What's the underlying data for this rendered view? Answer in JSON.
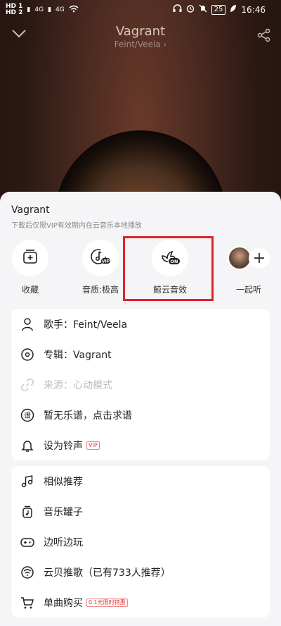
{
  "status": {
    "left_text": [
      "HD 1",
      "HD 2",
      "4G",
      "4G"
    ],
    "battery": "25",
    "time": "16:46"
  },
  "header": {
    "title": "Vagrant",
    "artist": "Feint/Veela",
    "icons": [
      "chevron-down-icon",
      "share-icon"
    ]
  },
  "sheet": {
    "title": "Vagrant",
    "subtitle": "下载后仅限VIP有效期内在云音乐本地播放",
    "actions": [
      {
        "label": "收藏",
        "icon": "add-to-playlist-icon"
      },
      {
        "label": "音质:极高",
        "icon": "audio-quality-vip-icon"
      },
      {
        "label": "鲸云音效",
        "icon": "whale-sound-effect-on-icon"
      },
      {
        "label": "一起听",
        "icon": "listen-together-icon"
      }
    ],
    "card1": [
      {
        "label": "歌手：Feint/Veela",
        "icon": "singer-icon",
        "disabled": false
      },
      {
        "label": "专辑：Vagrant",
        "icon": "album-icon",
        "disabled": false
      },
      {
        "label": "来源：心动模式",
        "icon": "link-icon",
        "disabled": true
      },
      {
        "label": "暂无乐谱，点击求谱",
        "icon": "score-icon",
        "disabled": false
      },
      {
        "label": "设为铃声",
        "icon": "bell-icon",
        "tag": "VIP",
        "disabled": false
      }
    ],
    "card2": [
      {
        "label": "相似推荐",
        "icon": "music-notes-icon"
      },
      {
        "label": "音乐罐子",
        "icon": "music-jar-icon"
      },
      {
        "label": "边听边玩",
        "icon": "gamepad-icon"
      },
      {
        "label": "云贝推歌（已有733人推荐）",
        "icon": "cloud-coin-icon"
      },
      {
        "label": "单曲购买",
        "icon": "cart-icon",
        "tag": "0.1元限时特惠"
      }
    ]
  }
}
